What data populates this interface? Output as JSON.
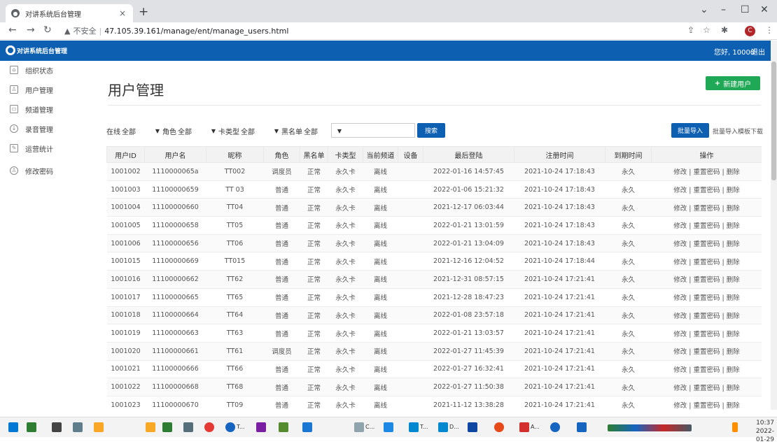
{
  "browser": {
    "tab_title": "对讲系统后台管理",
    "tab_close": "×",
    "new_tab": "+",
    "insecure_label": "不安全",
    "url": "47.105.39.161/manage/ent/manage_users.html"
  },
  "header": {
    "app_name": "对讲系统后台管理",
    "greeting": "您好, 10000",
    "logout": "退出"
  },
  "sidebar": {
    "items": [
      {
        "label": "组织状态",
        "icon": "home-icon"
      },
      {
        "label": "用户管理",
        "icon": "users-icon"
      },
      {
        "label": "频道管理",
        "icon": "channel-icon"
      },
      {
        "label": "录音管理",
        "icon": "download-icon"
      },
      {
        "label": "运营统计",
        "icon": "edit-icon"
      },
      {
        "label": "修改密码",
        "icon": "user-icon"
      }
    ]
  },
  "main": {
    "title": "用户管理",
    "new_user_button": "新建用户"
  },
  "filters": {
    "online_label": "在线",
    "online_value": "全部",
    "role_label": "角色",
    "role_value": "全部",
    "card_label": "卡类型",
    "card_value": "全部",
    "blacklist_label": "黑名单",
    "blacklist_value": "全部",
    "search_value": "",
    "search_button": "搜索",
    "batch_import_button": "批量导入",
    "template_link": "批量导入模板下载"
  },
  "table": {
    "headers": [
      "用户ID",
      "用户名",
      "昵称",
      "角色",
      "黑名单",
      "卡类型",
      "当前频道",
      "设备",
      "最后登陆",
      "注册时间",
      "到期时间",
      "操作"
    ],
    "rows": [
      [
        "1001002",
        "1110000065a",
        "TT002",
        "调度员",
        "正常",
        "永久卡",
        "离线",
        "",
        "2022-01-16 14:57:45",
        "2021-10-24 17:18:43",
        "永久"
      ],
      [
        "1001003",
        "11100000659",
        "TT 03",
        "普通",
        "正常",
        "永久卡",
        "离线",
        "",
        "2022-01-06 15:21:32",
        "2021-10-24 17:18:43",
        "永久"
      ],
      [
        "1001004",
        "11100000660",
        "TT04",
        "普通",
        "正常",
        "永久卡",
        "离线",
        "",
        "2021-12-17 06:03:44",
        "2021-10-24 17:18:43",
        "永久"
      ],
      [
        "1001005",
        "11100000658",
        "TT05",
        "普通",
        "正常",
        "永久卡",
        "离线",
        "",
        "2022-01-21 13:01:59",
        "2021-10-24 17:18:43",
        "永久"
      ],
      [
        "1001006",
        "11100000656",
        "TT06",
        "普通",
        "正常",
        "永久卡",
        "离线",
        "",
        "2022-01-21 13:04:09",
        "2021-10-24 17:18:43",
        "永久"
      ],
      [
        "1001015",
        "11100000669",
        "TT015",
        "普通",
        "正常",
        "永久卡",
        "离线",
        "",
        "2021-12-16 12:04:52",
        "2021-10-24 17:18:44",
        "永久"
      ],
      [
        "1001016",
        "11100000662",
        "TT62",
        "普通",
        "正常",
        "永久卡",
        "离线",
        "",
        "2021-12-31 08:57:15",
        "2021-10-24 17:21:41",
        "永久"
      ],
      [
        "1001017",
        "11100000665",
        "TT65",
        "普通",
        "正常",
        "永久卡",
        "离线",
        "",
        "2021-12-28 18:47:23",
        "2021-10-24 17:21:41",
        "永久"
      ],
      [
        "1001018",
        "11100000664",
        "TT64",
        "普通",
        "正常",
        "永久卡",
        "离线",
        "",
        "2022-01-08 23:57:18",
        "2021-10-24 17:21:41",
        "永久"
      ],
      [
        "1001019",
        "11100000663",
        "TT63",
        "普通",
        "正常",
        "永久卡",
        "离线",
        "",
        "2022-01-21 13:03:57",
        "2021-10-24 17:21:41",
        "永久"
      ],
      [
        "1001020",
        "11100000661",
        "TT61",
        "调度员",
        "正常",
        "永久卡",
        "离线",
        "",
        "2022-01-27 11:45:39",
        "2021-10-24 17:21:41",
        "永久"
      ],
      [
        "1001021",
        "11100000666",
        "TT66",
        "普通",
        "正常",
        "永久卡",
        "离线",
        "",
        "2022-01-27 16:32:41",
        "2021-10-24 17:21:41",
        "永久"
      ],
      [
        "1001022",
        "11100000668",
        "TT68",
        "普通",
        "正常",
        "永久卡",
        "离线",
        "",
        "2022-01-27 11:50:38",
        "2021-10-24 17:21:41",
        "永久"
      ],
      [
        "1001023",
        "11100000670",
        "TT09",
        "普通",
        "正常",
        "永久卡",
        "离线",
        "",
        "2021-11-12 13:38:28",
        "2021-10-24 17:21:41",
        "永久"
      ]
    ],
    "actions": {
      "edit": "修改",
      "reset": "重置密码",
      "delete": "删除",
      "sep": " | "
    }
  },
  "taskbar": {
    "time": "10:37",
    "date": "2022-01-29",
    "labels": [
      "T...",
      "C...",
      "T...",
      "D...",
      "A..."
    ]
  },
  "colors": {
    "header_blue": "#0d5fb2",
    "success_green": "#1fa855"
  }
}
